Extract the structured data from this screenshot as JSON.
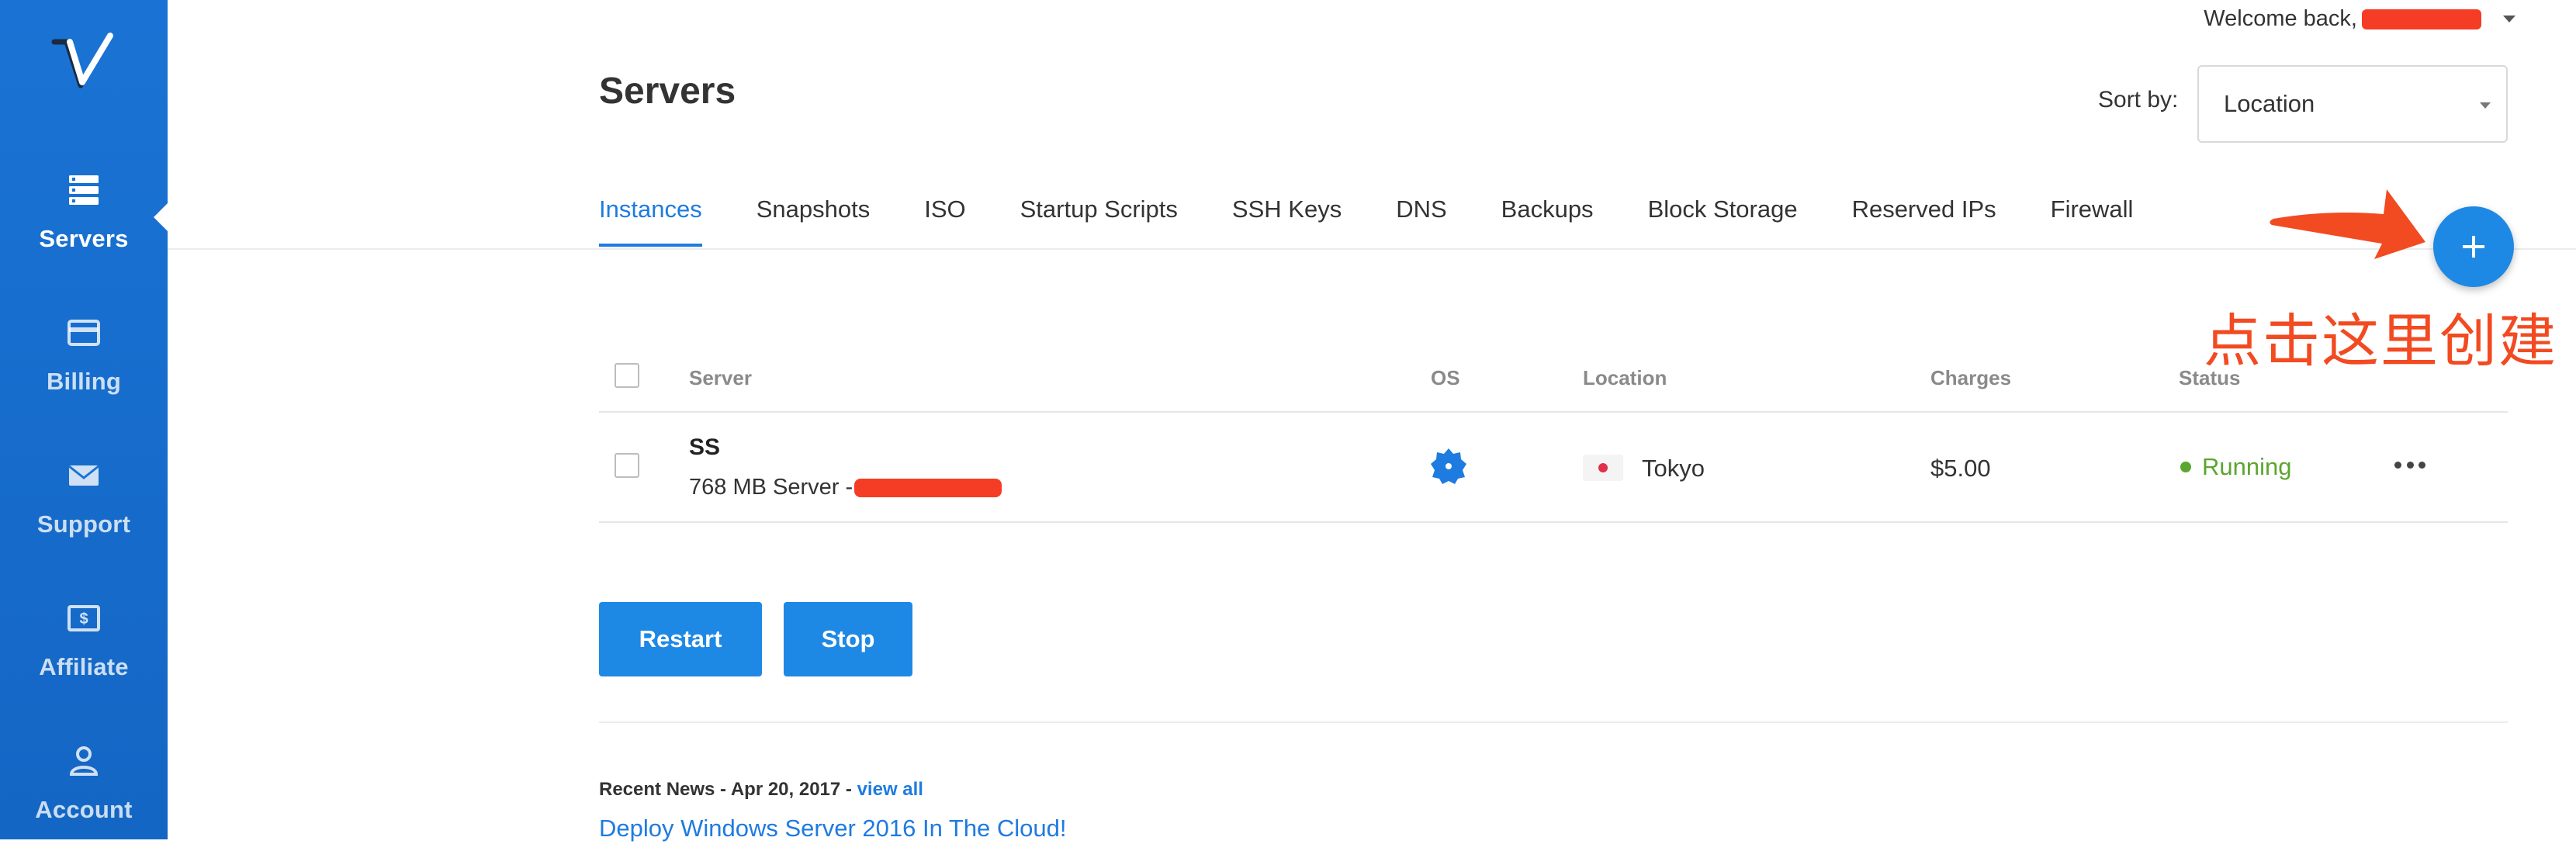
{
  "sidebar": {
    "logo_icon": "vultr-v-logo-icon",
    "items": [
      {
        "label": "Servers",
        "icon": "server-stack-icon",
        "active": true
      },
      {
        "label": "Billing",
        "icon": "credit-card-icon"
      },
      {
        "label": "Support",
        "icon": "envelope-icon"
      },
      {
        "label": "Affiliate",
        "icon": "dollar-bill-icon"
      },
      {
        "label": "Account",
        "icon": "user-icon"
      }
    ]
  },
  "header": {
    "welcome_text": "Welcome back,",
    "page_title": "Servers",
    "sort_label": "Sort by:",
    "sort_value": "Location"
  },
  "tabs": [
    {
      "label": "Instances",
      "active": true
    },
    {
      "label": "Snapshots"
    },
    {
      "label": "ISO"
    },
    {
      "label": "Startup Scripts"
    },
    {
      "label": "SSH Keys"
    },
    {
      "label": "DNS"
    },
    {
      "label": "Backups"
    },
    {
      "label": "Block Storage"
    },
    {
      "label": "Reserved IPs"
    },
    {
      "label": "Firewall"
    }
  ],
  "add_button": {
    "icon": "plus-icon"
  },
  "annotation": {
    "text": "点击这里创建",
    "icon": "red-arrow-icon",
    "color": "#f24a21"
  },
  "table": {
    "columns": [
      "Server",
      "OS",
      "Location",
      "Charges",
      "Status"
    ],
    "rows": [
      {
        "name": "SS",
        "description": "768 MB Server -",
        "os_icon": "os-badge-icon",
        "flag_icon": "japan-flag-icon",
        "location": "Tokyo",
        "charges": "$5.00",
        "status": "Running",
        "status_color": "#5aa62e",
        "more_icon": "more-dots-icon"
      }
    ]
  },
  "actions": {
    "restart": "Restart",
    "stop": "Stop"
  },
  "news": {
    "prefix": "Recent News - Apr 20, 2017 - ",
    "view_all": "view all",
    "headline": "Deploy Windows Server 2016 In The Cloud!"
  },
  "colors": {
    "primary": "#1e88e5",
    "sidebar": "#1a73d4",
    "redaction": "#f53c25"
  }
}
